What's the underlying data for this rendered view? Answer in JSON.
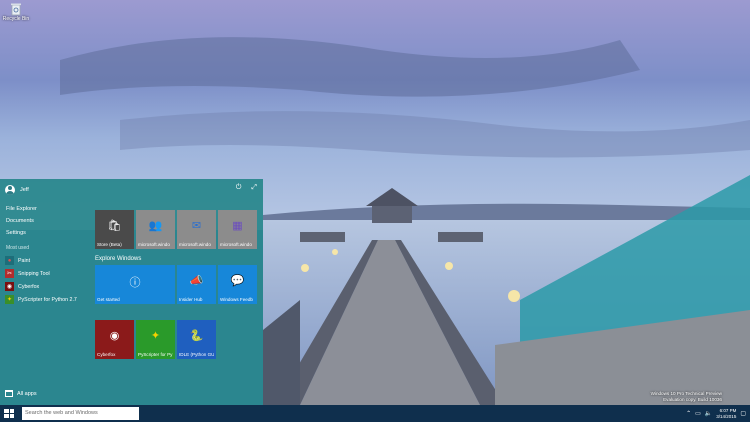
{
  "desktop": {
    "recycle_bin_label": "Recycle Bin"
  },
  "start_menu": {
    "user_name": "Jeff",
    "places": [
      "File Explorer",
      "Documents",
      "Settings"
    ],
    "most_used_label": "Most used",
    "most_used": [
      {
        "label": "Paint",
        "icon": "paint-icon",
        "color": "#c0392b"
      },
      {
        "label": "Snipping Tool",
        "icon": "scissors-icon",
        "color": "#b22d2d"
      },
      {
        "label": "Cyberfox",
        "icon": "cyberfox-icon",
        "color": "#7a1010"
      },
      {
        "label": "PyScripter for Python 2.7",
        "icon": "pyscripter-icon",
        "color": "#3a8f2a"
      }
    ],
    "all_apps_label": "All apps",
    "explore_label": "Explore Windows",
    "tiles_row1": [
      {
        "label": "Store (Beta)",
        "icon": "store-icon",
        "color": "#4a4a4a"
      },
      {
        "label": "microsoft.windo",
        "icon": "people-icon",
        "color": "#8c8c8c"
      },
      {
        "label": "microsoft.windo",
        "icon": "mail-icon",
        "color": "#8c8c8c"
      },
      {
        "label": "microsoft.windo",
        "icon": "calendar-icon",
        "color": "#8c8c8c"
      }
    ],
    "tiles_row2": [
      {
        "label": "Get started",
        "icon": "question-icon",
        "color": "#1787d9"
      },
      {
        "label": "Insider Hub",
        "icon": "megaphone-icon",
        "color": "#1787d9"
      },
      {
        "label": "Windows Feedb",
        "icon": "feedback-icon",
        "color": "#1787d9"
      }
    ],
    "tiles_row3": [
      {
        "label": "Cyberfox",
        "icon": "cyberfox-icon",
        "color": "#8b1a1a"
      },
      {
        "label": "PyScripter for Py",
        "icon": "pyscripter-icon",
        "color": "#2a9a2a"
      },
      {
        "label": "IDLE (Python GU",
        "icon": "python-icon",
        "color": "#1f5fbf"
      }
    ]
  },
  "taskbar": {
    "search_placeholder": "Search the web and Windows",
    "time": "6:07 PM",
    "date": "3/14/2015"
  },
  "watermark": {
    "line1": "Windows 10 Pro Technical Preview",
    "line2": "Evaluation copy. Build 10036"
  }
}
